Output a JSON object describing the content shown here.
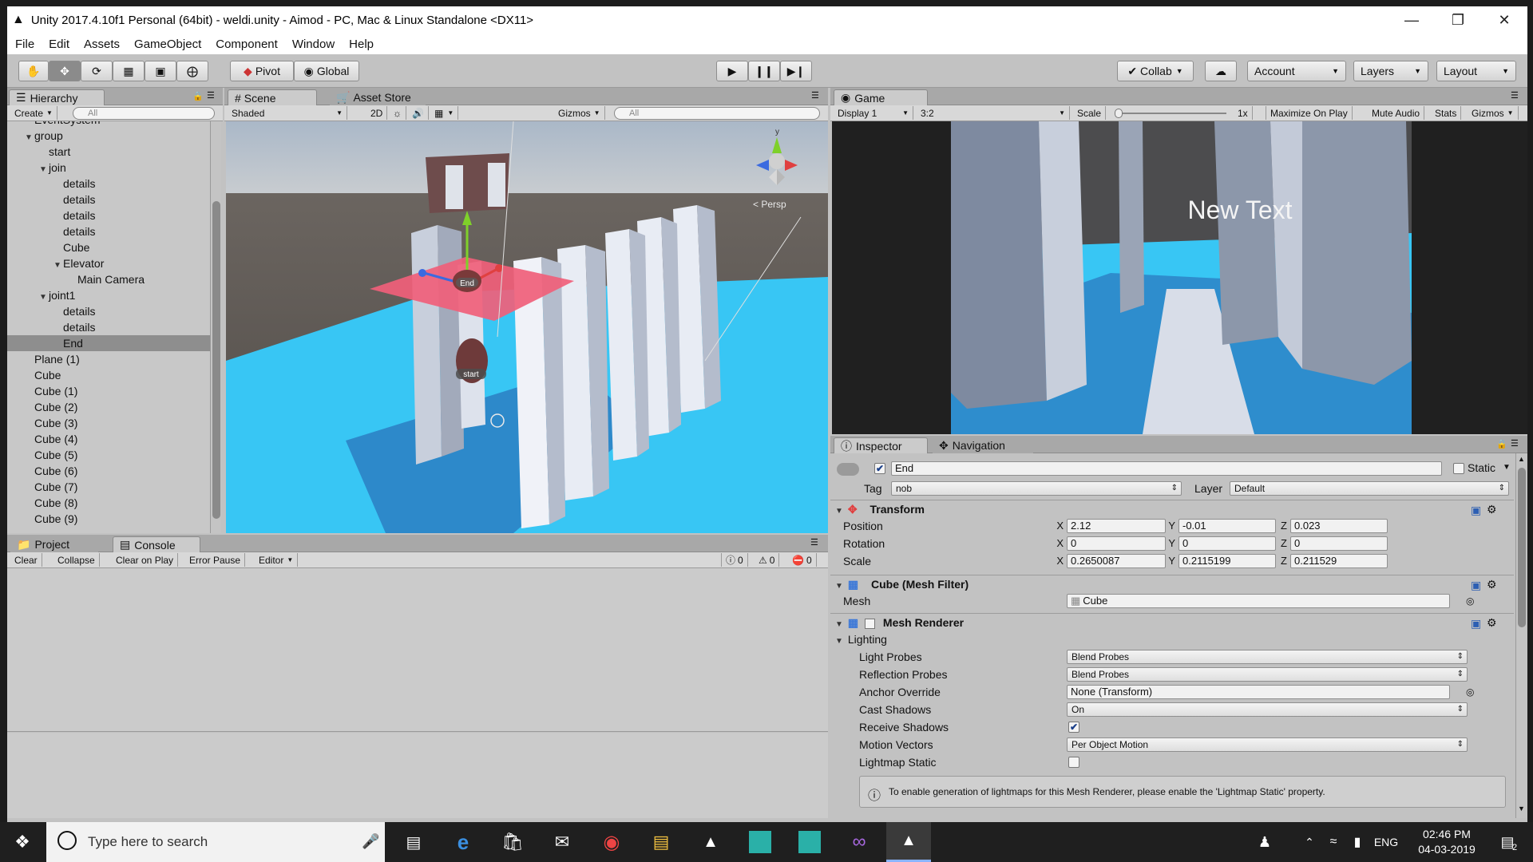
{
  "window": {
    "title": "Unity 2017.4.10f1 Personal (64bit) - weldi.unity - Aimod - PC, Mac & Linux Standalone <DX11>",
    "minimize": "—",
    "restore": "❐",
    "close": "✕"
  },
  "menu": [
    "File",
    "Edit",
    "Assets",
    "GameObject",
    "Component",
    "Window",
    "Help"
  ],
  "toolbar": {
    "pivot": "Pivot",
    "global": "Global",
    "collab": "Collab",
    "account": "Account",
    "layers": "Layers",
    "layout": "Layout"
  },
  "hierarchy": {
    "tab": "Hierarchy",
    "create": "Create",
    "search_placeholder": "All",
    "items": [
      {
        "label": "EventSystem",
        "indent": 0,
        "arrow": ""
      },
      {
        "label": "group",
        "indent": 0,
        "arrow": "▼"
      },
      {
        "label": "start",
        "indent": 1,
        "arrow": ""
      },
      {
        "label": "join",
        "indent": 1,
        "arrow": "▼"
      },
      {
        "label": "details",
        "indent": 2,
        "arrow": ""
      },
      {
        "label": "details",
        "indent": 2,
        "arrow": ""
      },
      {
        "label": "details",
        "indent": 2,
        "arrow": ""
      },
      {
        "label": "details",
        "indent": 2,
        "arrow": ""
      },
      {
        "label": "Cube",
        "indent": 2,
        "arrow": ""
      },
      {
        "label": "Elevator",
        "indent": 2,
        "arrow": "▼"
      },
      {
        "label": "Main Camera",
        "indent": 3,
        "arrow": ""
      },
      {
        "label": "joint1",
        "indent": 1,
        "arrow": "▼"
      },
      {
        "label": "details",
        "indent": 2,
        "arrow": ""
      },
      {
        "label": "details",
        "indent": 2,
        "arrow": ""
      },
      {
        "label": "End",
        "indent": 2,
        "arrow": "",
        "selected": true
      },
      {
        "label": "Plane (1)",
        "indent": 0,
        "arrow": ""
      },
      {
        "label": "Cube",
        "indent": 0,
        "arrow": ""
      },
      {
        "label": "Cube (1)",
        "indent": 0,
        "arrow": ""
      },
      {
        "label": "Cube (2)",
        "indent": 0,
        "arrow": ""
      },
      {
        "label": "Cube (3)",
        "indent": 0,
        "arrow": ""
      },
      {
        "label": "Cube (4)",
        "indent": 0,
        "arrow": ""
      },
      {
        "label": "Cube (5)",
        "indent": 0,
        "arrow": ""
      },
      {
        "label": "Cube (6)",
        "indent": 0,
        "arrow": ""
      },
      {
        "label": "Cube (7)",
        "indent": 0,
        "arrow": ""
      },
      {
        "label": "Cube (8)",
        "indent": 0,
        "arrow": ""
      },
      {
        "label": "Cube (9)",
        "indent": 0,
        "arrow": ""
      }
    ]
  },
  "scene": {
    "tab_scene": "Scene",
    "tab_store": "Asset Store",
    "shaded": "Shaded",
    "mode2d": "2D",
    "gizmos": "Gizmos",
    "search_placeholder": "All",
    "persp": "< Persp",
    "gizmo_y": "y",
    "label_end": "End",
    "label_start": "start"
  },
  "game": {
    "tab": "Game",
    "display": "Display 1",
    "aspect": "3:2",
    "scale_label": "Scale",
    "scale_value": "1x",
    "maximize": "Maximize On Play",
    "mute": "Mute Audio",
    "stats": "Stats",
    "gizmos": "Gizmos",
    "overlay_text": "New Text"
  },
  "console": {
    "tab_project": "Project",
    "tab_console": "Console",
    "clear": "Clear",
    "collapse": "Collapse",
    "clear_on_play": "Clear on Play",
    "error_pause": "Error Pause",
    "editor": "Editor",
    "info_count": "0",
    "warn_count": "0",
    "error_count": "0"
  },
  "inspector": {
    "tab_inspector": "Inspector",
    "tab_navigation": "Navigation",
    "object_name": "End",
    "static_label": "Static",
    "tag_label": "Tag",
    "tag_value": "nob",
    "layer_label": "Layer",
    "layer_value": "Default",
    "transform": {
      "title": "Transform",
      "position_label": "Position",
      "rotation_label": "Rotation",
      "scale_label": "Scale",
      "position": {
        "x": "2.12",
        "y": "-0.01",
        "z": "0.023"
      },
      "rotation": {
        "x": "0",
        "y": "0",
        "z": "0"
      },
      "scale": {
        "x": "0.2650087",
        "y": "0.2115199",
        "z": "0.211529"
      }
    },
    "mesh_filter": {
      "title": "Cube (Mesh Filter)",
      "mesh_label": "Mesh",
      "mesh_value": "Cube"
    },
    "mesh_renderer": {
      "title": "Mesh Renderer",
      "lighting": "Lighting",
      "light_probes_label": "Light Probes",
      "light_probes_value": "Blend Probes",
      "reflection_probes_label": "Reflection Probes",
      "reflection_probes_value": "Blend Probes",
      "anchor_override_label": "Anchor Override",
      "anchor_override_value": "None (Transform)",
      "cast_shadows_label": "Cast Shadows",
      "cast_shadows_value": "On",
      "receive_shadows_label": "Receive Shadows",
      "motion_vectors_label": "Motion Vectors",
      "motion_vectors_value": "Per Object Motion",
      "lightmap_static_label": "Lightmap Static",
      "info": "To enable generation of lightmaps for this Mesh Renderer, please enable the 'Lightmap Static' property."
    }
  },
  "taskbar": {
    "search_placeholder": "Type here to search",
    "lang": "ENG",
    "time": "02:46 PM",
    "date": "04-03-2019",
    "notif_count": "2"
  },
  "colors": {
    "unity_bg": "#c2c2c2",
    "ground": "#38c6f4",
    "plane_red": "#f0607a",
    "selection": "#8e8e8e"
  }
}
